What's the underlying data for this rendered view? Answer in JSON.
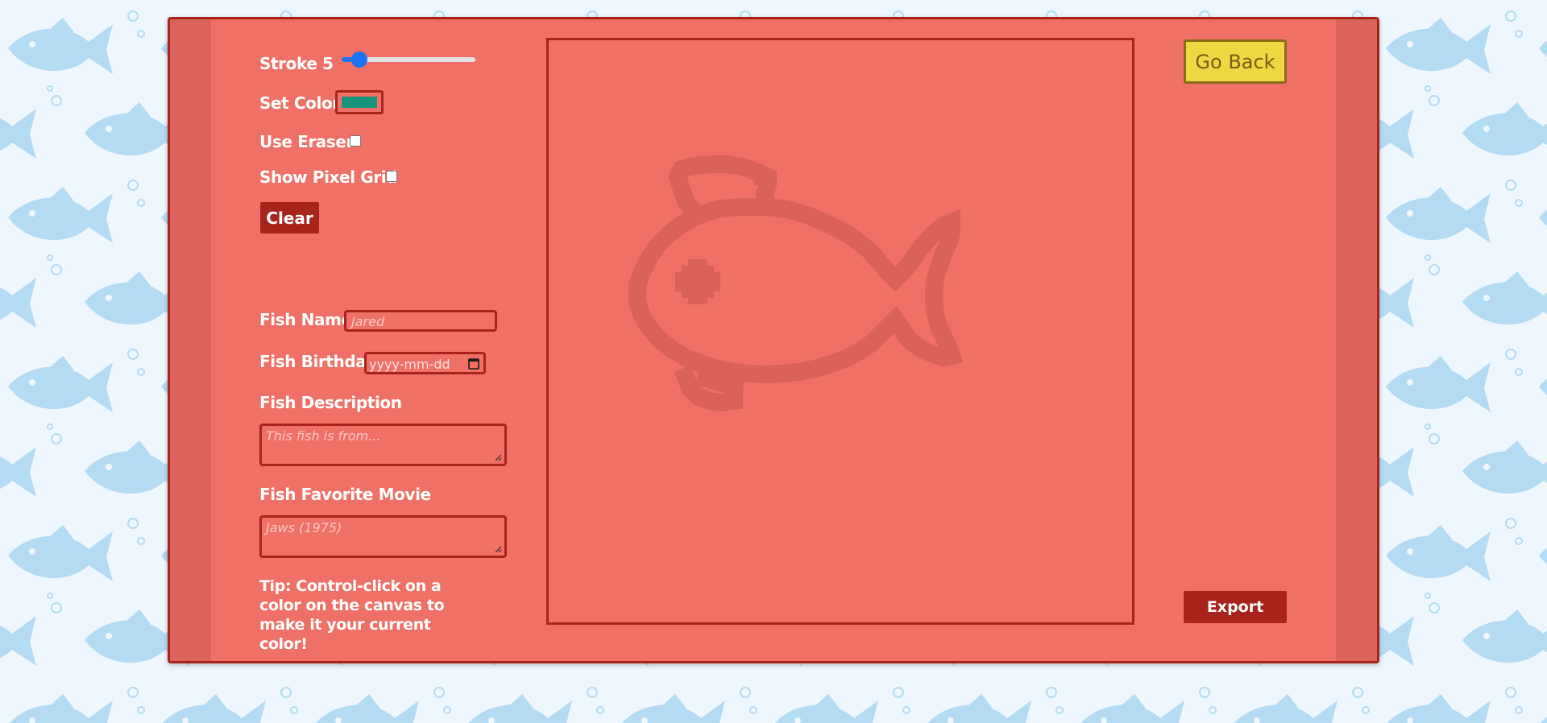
{
  "colors": {
    "background": "#eef7fd",
    "fish_pattern": "#b3dbf3",
    "panel": "#ef7066",
    "panel_band": "#da635b",
    "panel_border": "#a8231c",
    "accent_button": "#a8231c",
    "go_back_bg": "#eed841",
    "selected_color": "#16947c",
    "fish_sketch": "#d9625a"
  },
  "controls": {
    "stroke_label": "Stroke 5",
    "stroke_value": 5,
    "stroke_min": 1,
    "stroke_max": 50,
    "set_color_label": "Set Color",
    "use_eraser_label": "Use Eraser",
    "use_eraser_checked": false,
    "show_grid_label": "Show Pixel Grid",
    "show_grid_checked": false,
    "clear_label": "Clear"
  },
  "form": {
    "name_label": "Fish Name",
    "name_placeholder": "Jared",
    "birthday_label": "Fish Birthday",
    "birthday_placeholder": "yyyy-mm-dd",
    "description_label": "Fish Description",
    "description_placeholder": "This fish is from...",
    "movie_label": "Fish Favorite Movie",
    "movie_placeholder": "Jaws (1975)"
  },
  "tip": "Tip: Control-click on a color on the canvas to make it your current color!",
  "buttons": {
    "go_back": "Go Back",
    "export": "Export"
  },
  "icons": {
    "calendar": "calendar-icon",
    "resize": "resize-grip-icon",
    "fish": "fish-outline-icon"
  }
}
